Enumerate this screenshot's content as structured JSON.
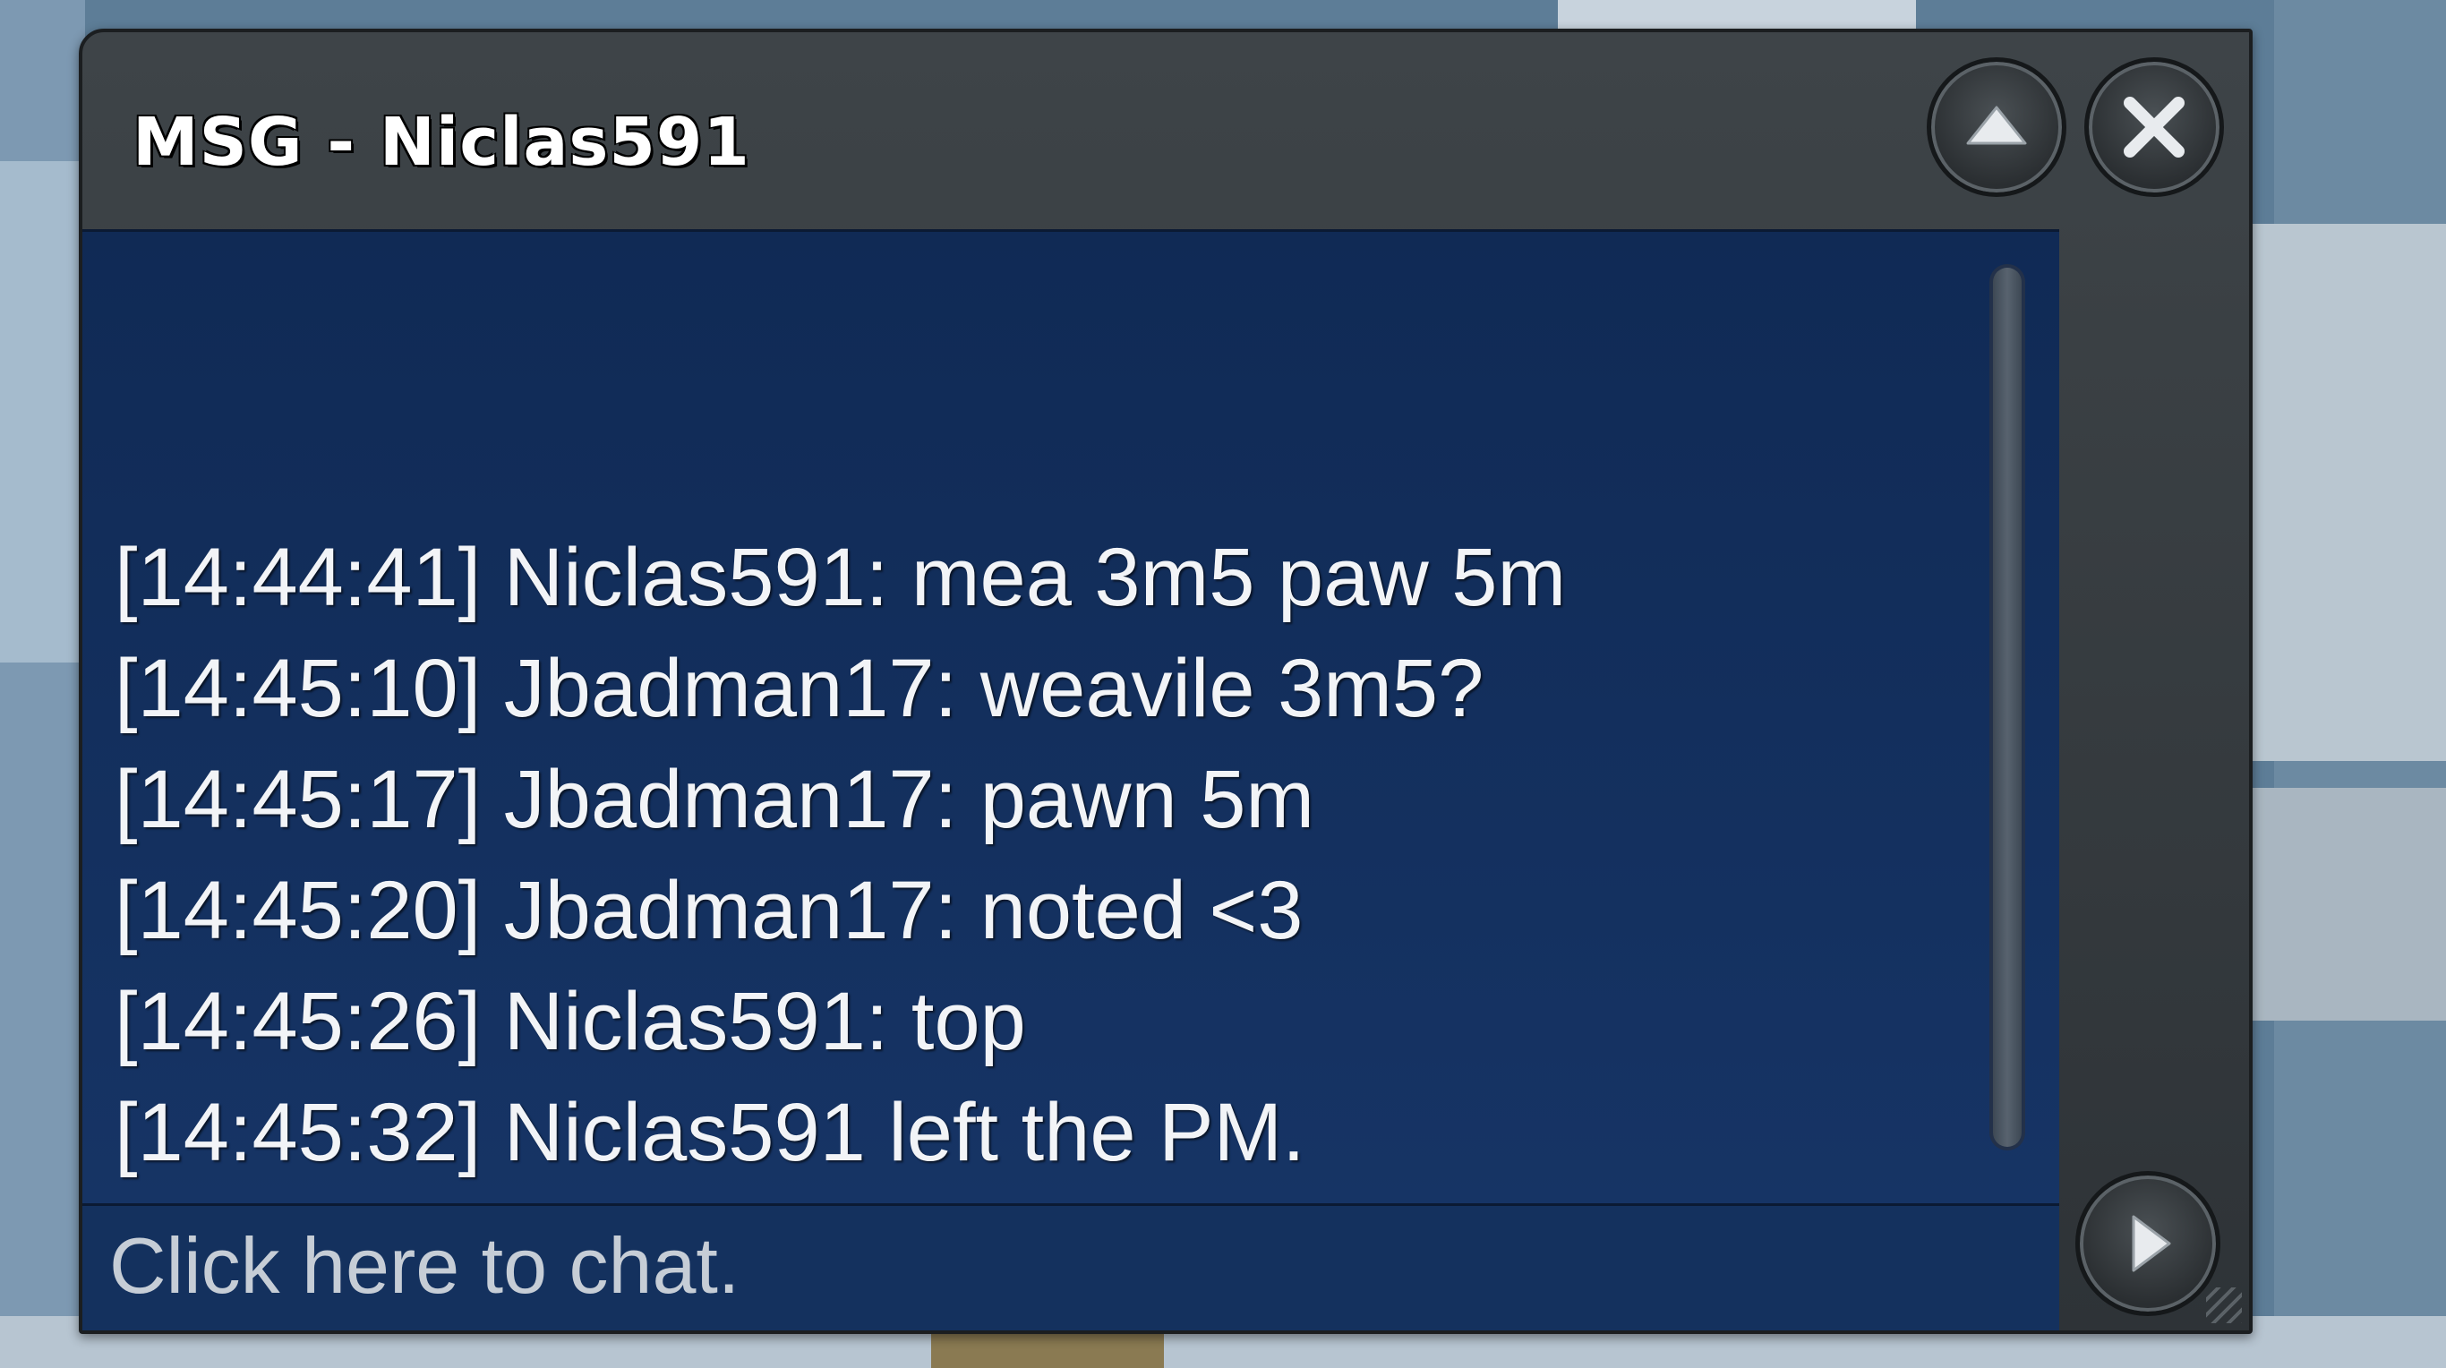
{
  "window": {
    "title": "MSG - Niclas591"
  },
  "buttons": {
    "minimize_icon": "chevron-up-icon",
    "close_icon": "close-icon",
    "send_icon": "send-arrow-icon"
  },
  "messages": [
    "[14:44:41] Niclas591: mea 3m5 paw 5m",
    "[14:45:10] Jbadman17: weavile 3m5?",
    "[14:45:17] Jbadman17: pawn 5m",
    "[14:45:20] Jbadman17: noted <3",
    "[14:45:26] Niclas591: top",
    "[14:45:32] Niclas591 left the PM."
  ],
  "input": {
    "placeholder": "Click here to chat."
  },
  "colors": {
    "frame": "#33393d",
    "message_bg": "#12305e",
    "text": "#f2f4f7"
  }
}
